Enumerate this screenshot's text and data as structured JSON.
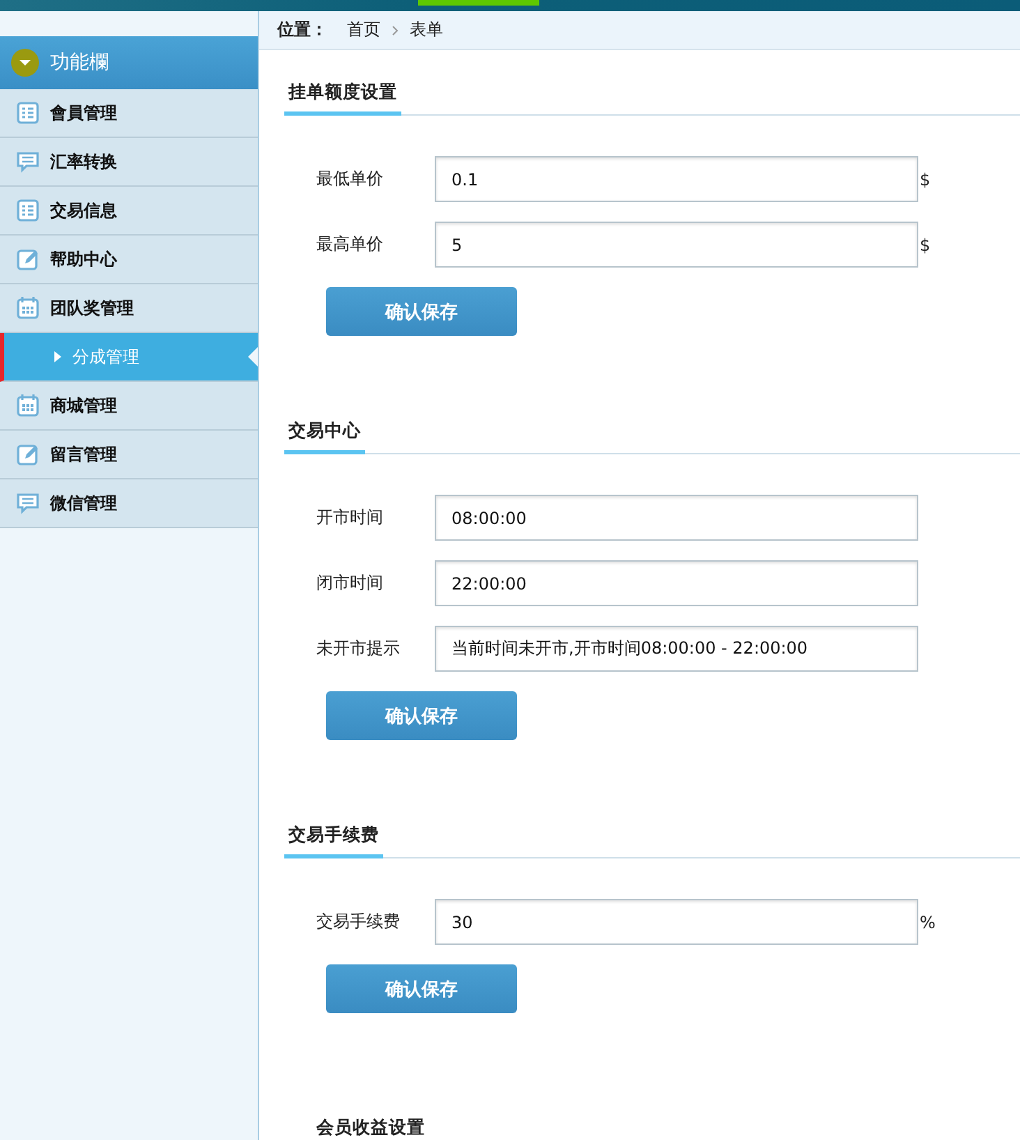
{
  "sidebar": {
    "title": "功能欄",
    "items": [
      {
        "label": "會員管理",
        "kind": "list",
        "selected": false
      },
      {
        "label": "汇率转换",
        "kind": "chat",
        "selected": false
      },
      {
        "label": "交易信息",
        "kind": "list",
        "selected": false
      },
      {
        "label": "帮助中心",
        "kind": "edit",
        "selected": false
      },
      {
        "label": "团队奖管理",
        "kind": "calendar",
        "selected": false
      },
      {
        "label": "分成管理",
        "kind": "sub",
        "selected": true
      },
      {
        "label": "商城管理",
        "kind": "calendar",
        "selected": false
      },
      {
        "label": "留言管理",
        "kind": "edit",
        "selected": false
      },
      {
        "label": "微信管理",
        "kind": "chat",
        "selected": false
      }
    ]
  },
  "breadcrumb": {
    "label": "位置：",
    "items": [
      "首页",
      "表单"
    ]
  },
  "sections": [
    {
      "title": "挂单额度设置",
      "fields": [
        {
          "label": "最低单价",
          "value": "0.1",
          "unit": "$"
        },
        {
          "label": "最高单价",
          "value": "5",
          "unit": "$"
        }
      ],
      "button": "确认保存"
    },
    {
      "title": "交易中心",
      "fields": [
        {
          "label": "开市时间",
          "value": "08:00:00"
        },
        {
          "label": "闭市时间",
          "value": "22:00:00"
        },
        {
          "label": "未开市提示",
          "value": "当前时间未开市,开市时间08:00:00 - 22:00:00"
        }
      ],
      "button": "确认保存"
    },
    {
      "title": "交易手续费",
      "fields": [
        {
          "label": "交易手续费",
          "value": "30",
          "unit": "%"
        }
      ],
      "button": "确认保存"
    }
  ],
  "next_section_title": "会员收益设置"
}
